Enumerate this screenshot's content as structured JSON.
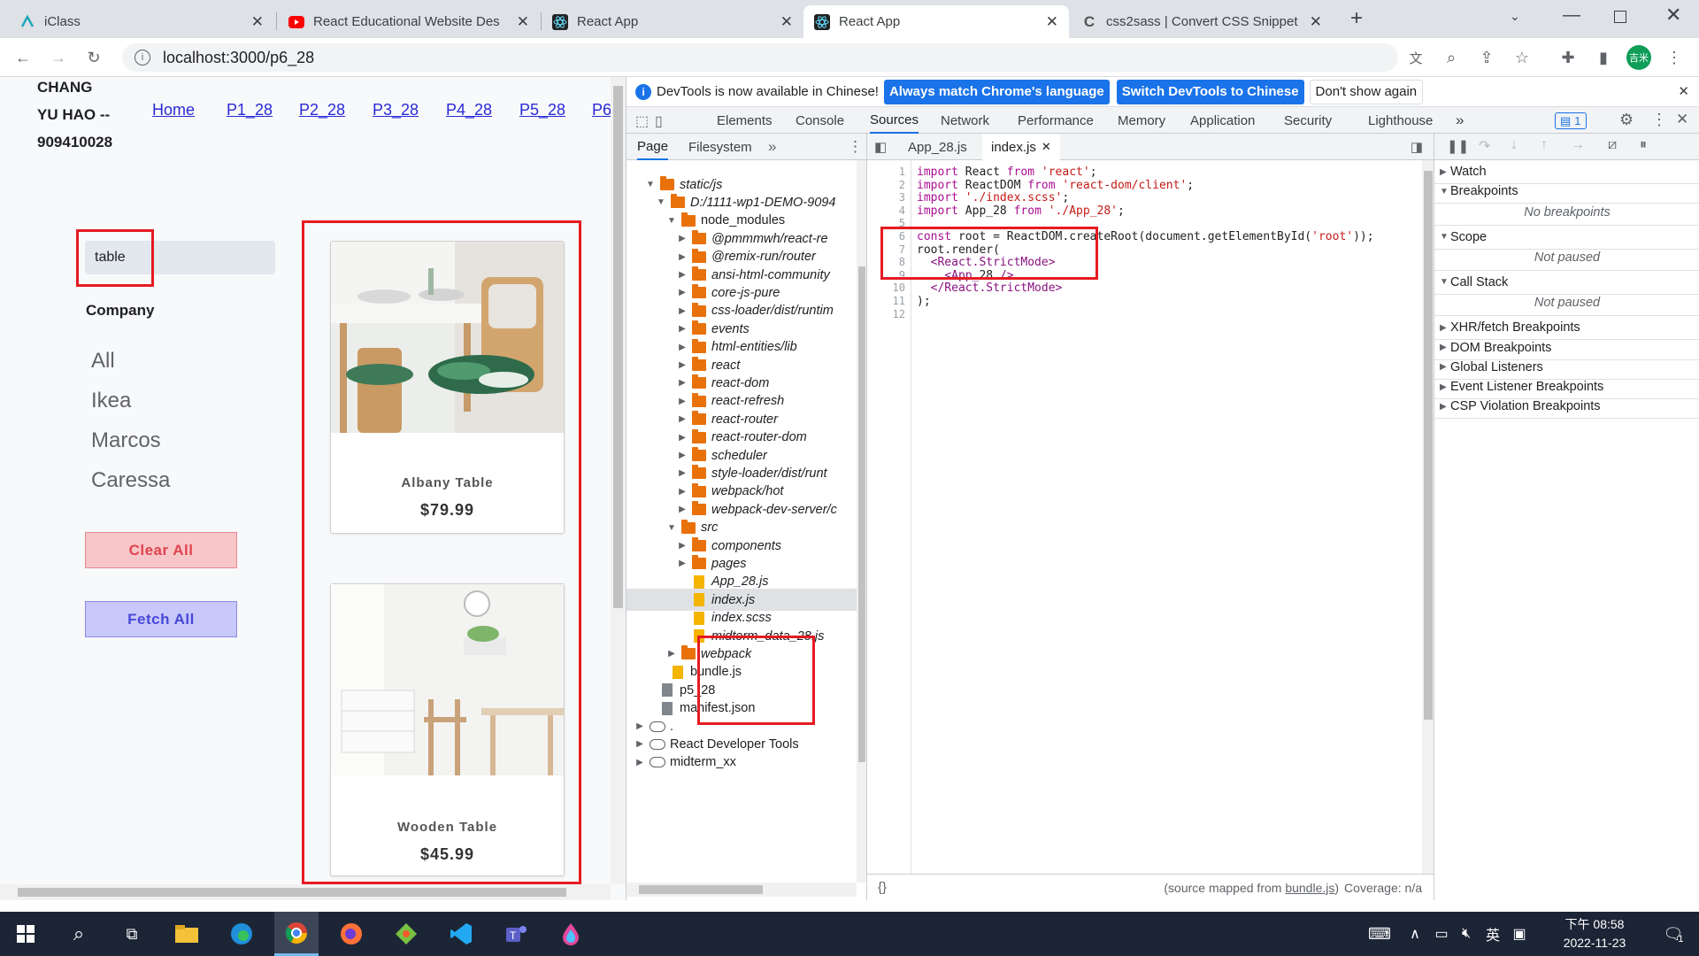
{
  "browser": {
    "tabs": [
      {
        "title": "iClass",
        "icon": "iclass-icon"
      },
      {
        "title": "React Educational Website Des",
        "icon": "youtube-icon"
      },
      {
        "title": "React App",
        "icon": "react-icon"
      },
      {
        "title": "React App",
        "icon": "react-icon"
      },
      {
        "title": "css2sass | Convert CSS Snippet",
        "icon": "css2sass-icon"
      }
    ],
    "new_tab": "+",
    "url": "localhost:3000/p6_28",
    "profile_initials": "吉米"
  },
  "app": {
    "name_line1": "CHANG",
    "name_line2": "YU HAO --",
    "student_id": "909410028",
    "nav": [
      "Home",
      "P1_28",
      "P2_28",
      "P3_28",
      "P4_28",
      "P5_28",
      "P6"
    ],
    "search_value": "table",
    "company_heading": "Company",
    "companies": [
      "All",
      "Ikea",
      "Marcos",
      "Caressa"
    ],
    "clear_label": "Clear All",
    "fetch_label": "Fetch All",
    "products": [
      {
        "name": "Albany Table",
        "price": "$79.99"
      },
      {
        "name": "Wooden Table",
        "price": "$45.99"
      }
    ]
  },
  "devtools": {
    "info_text": "DevTools is now available in Chinese!",
    "btn_match": "Always match Chrome's language",
    "btn_switch": "Switch DevTools to Chinese",
    "btn_dismiss": "Don't show again",
    "tabs": [
      "Elements",
      "Console",
      "Sources",
      "Network",
      "Performance",
      "Memory",
      "Application",
      "Security",
      "Lighthouse"
    ],
    "issues_count": "1",
    "navigator_tabs": [
      "Page",
      "Filesystem"
    ],
    "tree": [
      {
        "label": "static/js",
        "indent": 2,
        "type": "folder",
        "arrow": "▼",
        "italic": true
      },
      {
        "label": "D:/1111-wp1-DEMO-9094",
        "indent": 3,
        "type": "folder",
        "arrow": "▼",
        "italic": true
      },
      {
        "label": "node_modules",
        "indent": 4,
        "type": "folder",
        "arrow": "▼",
        "italic": false
      },
      {
        "label": "@pmmmwh/react-re",
        "indent": 5,
        "type": "folder",
        "arrow": "▶",
        "italic": true
      },
      {
        "label": "@remix-run/router",
        "indent": 5,
        "type": "folder",
        "arrow": "▶",
        "italic": true
      },
      {
        "label": "ansi-html-community",
        "indent": 5,
        "type": "folder",
        "arrow": "▶",
        "italic": true
      },
      {
        "label": "core-js-pure",
        "indent": 5,
        "type": "folder",
        "arrow": "▶",
        "italic": true
      },
      {
        "label": "css-loader/dist/runtim",
        "indent": 5,
        "type": "folder",
        "arrow": "▶",
        "italic": true
      },
      {
        "label": "events",
        "indent": 5,
        "type": "folder",
        "arrow": "▶",
        "italic": true
      },
      {
        "label": "html-entities/lib",
        "indent": 5,
        "type": "folder",
        "arrow": "▶",
        "italic": true
      },
      {
        "label": "react",
        "indent": 5,
        "type": "folder",
        "arrow": "▶",
        "italic": true
      },
      {
        "label": "react-dom",
        "indent": 5,
        "type": "folder",
        "arrow": "▶",
        "italic": true
      },
      {
        "label": "react-refresh",
        "indent": 5,
        "type": "folder",
        "arrow": "▶",
        "italic": true
      },
      {
        "label": "react-router",
        "indent": 5,
        "type": "folder",
        "arrow": "▶",
        "italic": true
      },
      {
        "label": "react-router-dom",
        "indent": 5,
        "type": "folder",
        "arrow": "▶",
        "italic": true
      },
      {
        "label": "scheduler",
        "indent": 5,
        "type": "folder",
        "arrow": "▶",
        "italic": true
      },
      {
        "label": "style-loader/dist/runt",
        "indent": 5,
        "type": "folder",
        "arrow": "▶",
        "italic": true
      },
      {
        "label": "webpack/hot",
        "indent": 5,
        "type": "folder",
        "arrow": "▶",
        "italic": true
      },
      {
        "label": "webpack-dev-server/c",
        "indent": 5,
        "type": "folder",
        "arrow": "▶",
        "italic": true
      },
      {
        "label": "src",
        "indent": 4,
        "type": "folder",
        "arrow": "▼",
        "italic": true
      },
      {
        "label": "components",
        "indent": 5,
        "type": "folder",
        "arrow": "▶",
        "italic": true
      },
      {
        "label": "pages",
        "indent": 5,
        "type": "folder",
        "arrow": "▶",
        "italic": true
      },
      {
        "label": "App_28.js",
        "indent": 5,
        "type": "file",
        "arrow": "",
        "italic": true
      },
      {
        "label": "index.js",
        "indent": 5,
        "type": "file",
        "arrow": "",
        "italic": true,
        "selected": true
      },
      {
        "label": "index.scss",
        "indent": 5,
        "type": "file",
        "arrow": "",
        "italic": true
      },
      {
        "label": "midterm_data_28.js",
        "indent": 5,
        "type": "file",
        "arrow": "",
        "italic": true
      },
      {
        "label": "webpack",
        "indent": 4,
        "type": "folder",
        "arrow": "▶",
        "italic": true
      },
      {
        "label": "bundle.js",
        "indent": 3,
        "type": "file",
        "arrow": "",
        "italic": false
      },
      {
        "label": "p5_28",
        "indent": 2,
        "type": "gfile",
        "arrow": "",
        "italic": false
      },
      {
        "label": "manifest.json",
        "indent": 2,
        "type": "gfile",
        "arrow": "",
        "italic": false
      },
      {
        "label": ".",
        "indent": 1,
        "type": "cloud",
        "arrow": "▶",
        "italic": false
      },
      {
        "label": "React Developer Tools",
        "indent": 1,
        "type": "cloud",
        "arrow": "▶",
        "italic": false
      },
      {
        "label": "midterm_xx",
        "indent": 1,
        "type": "cloud",
        "arrow": "▶",
        "italic": false
      }
    ],
    "editor_tabs": [
      "App_28.js",
      "index.js"
    ],
    "code_lines": [
      "import React from 'react';",
      "import ReactDOM from 'react-dom/client';",
      "import './index.scss';",
      "import App_28 from './App_28';",
      "",
      "const root = ReactDOM.createRoot(document.getElementById('root'));",
      "root.render(",
      "  <React.StrictMode>",
      "    <App_28 />",
      "  </React.StrictMode>",
      ");",
      ""
    ],
    "status_braces": "{}",
    "status_text_prefix": "(source mapped from ",
    "status_link": "bundle.js",
    "status_text_suffix": ")",
    "coverage": "Coverage: n/a",
    "side_sections": [
      {
        "label": "Watch",
        "arrow": "▶"
      },
      {
        "label": "Breakpoints",
        "arrow": "▼",
        "sub": "No breakpoints"
      },
      {
        "label": "Scope",
        "arrow": "▼",
        "sub": "Not paused"
      },
      {
        "label": "Call Stack",
        "arrow": "▼",
        "sub": "Not paused"
      },
      {
        "label": "XHR/fetch Breakpoints",
        "arrow": "▶"
      },
      {
        "label": "DOM Breakpoints",
        "arrow": "▶"
      },
      {
        "label": "Global Listeners",
        "arrow": "▶"
      },
      {
        "label": "Event Listener Breakpoints",
        "arrow": "▶"
      },
      {
        "label": "CSP Violation Breakpoints",
        "arrow": "▶"
      }
    ]
  },
  "taskbar": {
    "ime": "英",
    "time": "下午 08:58",
    "date": "2022-11-23",
    "notifications": "1"
  },
  "colors": {
    "annotation_red": "#e51b23",
    "devtools_blue": "#1a73e8",
    "link_blue": "#2a2ad8"
  }
}
